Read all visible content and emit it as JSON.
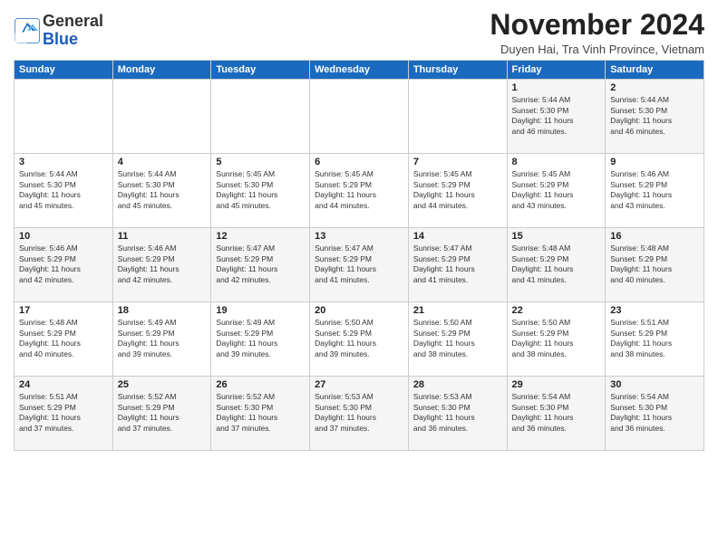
{
  "logo": {
    "text_general": "General",
    "text_blue": "Blue"
  },
  "title": {
    "month": "November 2024",
    "location": "Duyen Hai, Tra Vinh Province, Vietnam"
  },
  "weekdays": [
    "Sunday",
    "Monday",
    "Tuesday",
    "Wednesday",
    "Thursday",
    "Friday",
    "Saturday"
  ],
  "weeks": [
    [
      {
        "day": "",
        "info": ""
      },
      {
        "day": "",
        "info": ""
      },
      {
        "day": "",
        "info": ""
      },
      {
        "day": "",
        "info": ""
      },
      {
        "day": "",
        "info": ""
      },
      {
        "day": "1",
        "info": "Sunrise: 5:44 AM\nSunset: 5:30 PM\nDaylight: 11 hours\nand 46 minutes."
      },
      {
        "day": "2",
        "info": "Sunrise: 5:44 AM\nSunset: 5:30 PM\nDaylight: 11 hours\nand 46 minutes."
      }
    ],
    [
      {
        "day": "3",
        "info": "Sunrise: 5:44 AM\nSunset: 5:30 PM\nDaylight: 11 hours\nand 45 minutes."
      },
      {
        "day": "4",
        "info": "Sunrise: 5:44 AM\nSunset: 5:30 PM\nDaylight: 11 hours\nand 45 minutes."
      },
      {
        "day": "5",
        "info": "Sunrise: 5:45 AM\nSunset: 5:30 PM\nDaylight: 11 hours\nand 45 minutes."
      },
      {
        "day": "6",
        "info": "Sunrise: 5:45 AM\nSunset: 5:29 PM\nDaylight: 11 hours\nand 44 minutes."
      },
      {
        "day": "7",
        "info": "Sunrise: 5:45 AM\nSunset: 5:29 PM\nDaylight: 11 hours\nand 44 minutes."
      },
      {
        "day": "8",
        "info": "Sunrise: 5:45 AM\nSunset: 5:29 PM\nDaylight: 11 hours\nand 43 minutes."
      },
      {
        "day": "9",
        "info": "Sunrise: 5:46 AM\nSunset: 5:29 PM\nDaylight: 11 hours\nand 43 minutes."
      }
    ],
    [
      {
        "day": "10",
        "info": "Sunrise: 5:46 AM\nSunset: 5:29 PM\nDaylight: 11 hours\nand 42 minutes."
      },
      {
        "day": "11",
        "info": "Sunrise: 5:46 AM\nSunset: 5:29 PM\nDaylight: 11 hours\nand 42 minutes."
      },
      {
        "day": "12",
        "info": "Sunrise: 5:47 AM\nSunset: 5:29 PM\nDaylight: 11 hours\nand 42 minutes."
      },
      {
        "day": "13",
        "info": "Sunrise: 5:47 AM\nSunset: 5:29 PM\nDaylight: 11 hours\nand 41 minutes."
      },
      {
        "day": "14",
        "info": "Sunrise: 5:47 AM\nSunset: 5:29 PM\nDaylight: 11 hours\nand 41 minutes."
      },
      {
        "day": "15",
        "info": "Sunrise: 5:48 AM\nSunset: 5:29 PM\nDaylight: 11 hours\nand 41 minutes."
      },
      {
        "day": "16",
        "info": "Sunrise: 5:48 AM\nSunset: 5:29 PM\nDaylight: 11 hours\nand 40 minutes."
      }
    ],
    [
      {
        "day": "17",
        "info": "Sunrise: 5:48 AM\nSunset: 5:29 PM\nDaylight: 11 hours\nand 40 minutes."
      },
      {
        "day": "18",
        "info": "Sunrise: 5:49 AM\nSunset: 5:29 PM\nDaylight: 11 hours\nand 39 minutes."
      },
      {
        "day": "19",
        "info": "Sunrise: 5:49 AM\nSunset: 5:29 PM\nDaylight: 11 hours\nand 39 minutes."
      },
      {
        "day": "20",
        "info": "Sunrise: 5:50 AM\nSunset: 5:29 PM\nDaylight: 11 hours\nand 39 minutes."
      },
      {
        "day": "21",
        "info": "Sunrise: 5:50 AM\nSunset: 5:29 PM\nDaylight: 11 hours\nand 38 minutes."
      },
      {
        "day": "22",
        "info": "Sunrise: 5:50 AM\nSunset: 5:29 PM\nDaylight: 11 hours\nand 38 minutes."
      },
      {
        "day": "23",
        "info": "Sunrise: 5:51 AM\nSunset: 5:29 PM\nDaylight: 11 hours\nand 38 minutes."
      }
    ],
    [
      {
        "day": "24",
        "info": "Sunrise: 5:51 AM\nSunset: 5:29 PM\nDaylight: 11 hours\nand 37 minutes."
      },
      {
        "day": "25",
        "info": "Sunrise: 5:52 AM\nSunset: 5:29 PM\nDaylight: 11 hours\nand 37 minutes."
      },
      {
        "day": "26",
        "info": "Sunrise: 5:52 AM\nSunset: 5:30 PM\nDaylight: 11 hours\nand 37 minutes."
      },
      {
        "day": "27",
        "info": "Sunrise: 5:53 AM\nSunset: 5:30 PM\nDaylight: 11 hours\nand 37 minutes."
      },
      {
        "day": "28",
        "info": "Sunrise: 5:53 AM\nSunset: 5:30 PM\nDaylight: 11 hours\nand 36 minutes."
      },
      {
        "day": "29",
        "info": "Sunrise: 5:54 AM\nSunset: 5:30 PM\nDaylight: 11 hours\nand 36 minutes."
      },
      {
        "day": "30",
        "info": "Sunrise: 5:54 AM\nSunset: 5:30 PM\nDaylight: 11 hours\nand 36 minutes."
      }
    ]
  ]
}
